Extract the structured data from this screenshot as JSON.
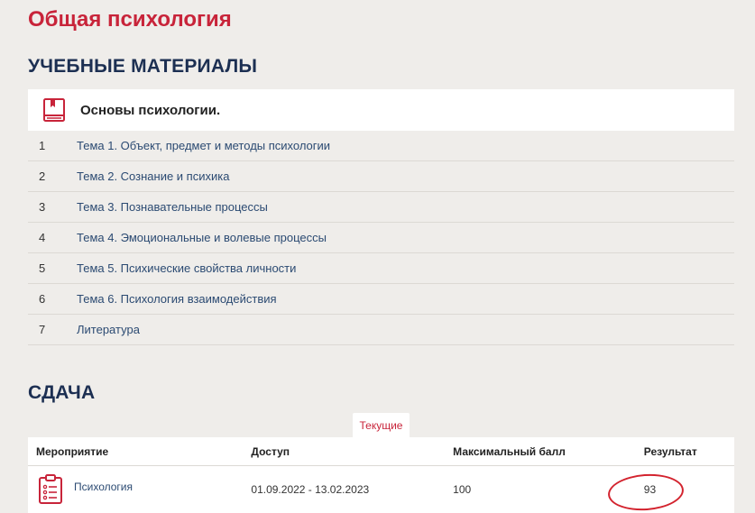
{
  "page": {
    "title": "Общая психология"
  },
  "materials": {
    "section_title": "УЧЕБНЫЕ МАТЕРИАЛЫ",
    "course_name": "Основы психологии.",
    "topics": [
      {
        "num": "1",
        "label": "Тема 1. Объект, предмет и методы психологии"
      },
      {
        "num": "2",
        "label": "Тема 2. Сознание и психика"
      },
      {
        "num": "3",
        "label": "Тема 3. Познавательные процессы"
      },
      {
        "num": "4",
        "label": "Тема 4. Эмоциональные и волевые процессы"
      },
      {
        "num": "5",
        "label": "Тема 5. Психические свойства личности"
      },
      {
        "num": "6",
        "label": "Тема 6. Психология взаимодействия"
      },
      {
        "num": "7",
        "label": "Литература"
      }
    ]
  },
  "sdacha": {
    "section_title": "СДАЧА",
    "tab_label": "Текущие",
    "columns": {
      "event": "Мероприятие",
      "access": "Доступ",
      "max_score": "Максимальный балл",
      "result": "Результат"
    },
    "rows": [
      {
        "event": "Психология",
        "access": "01.09.2022 - 13.02.2023",
        "max_score": "100",
        "result": "93"
      }
    ]
  },
  "colors": {
    "accent": "#c8243a",
    "heading": "#1c2f52",
    "link": "#2b4a72",
    "background": "#efedea"
  },
  "icons": {
    "course": "book-icon",
    "event": "clipboard-list-icon"
  }
}
